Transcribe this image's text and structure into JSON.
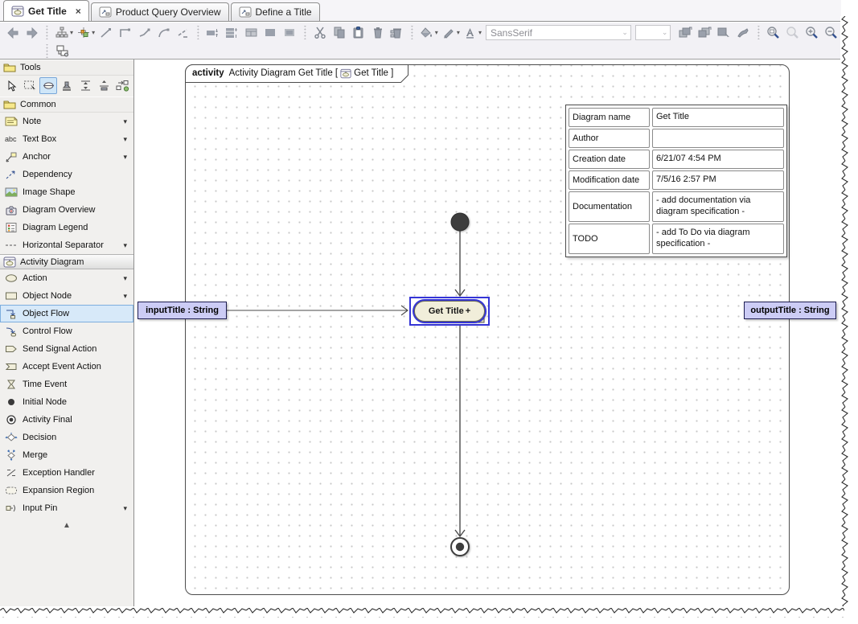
{
  "tabs": [
    {
      "label": "Get Title",
      "close_glyph": "×",
      "active": true
    },
    {
      "label": "Product Query Overview",
      "active": false
    },
    {
      "label": "Define a Title",
      "active": false
    }
  ],
  "toolbar": {
    "font_family": "SansSerif",
    "font_size": "",
    "combo_chevron": "⌄"
  },
  "palette": {
    "tools_header": "Tools",
    "common_header": "Common",
    "common_items": [
      {
        "label": "Note",
        "dropdown": "▾"
      },
      {
        "label": "Text Box",
        "dropdown": "▾"
      },
      {
        "label": "Anchor",
        "dropdown": "▾"
      },
      {
        "label": "Dependency",
        "dropdown": ""
      },
      {
        "label": "Image Shape",
        "dropdown": ""
      },
      {
        "label": "Diagram Overview",
        "dropdown": ""
      },
      {
        "label": "Diagram Legend",
        "dropdown": ""
      },
      {
        "label": "Horizontal Separator",
        "dropdown": "▾"
      }
    ],
    "activity_header": "Activity Diagram",
    "activity_items": [
      {
        "label": "Action",
        "dropdown": "▾"
      },
      {
        "label": "Object Node",
        "dropdown": "▾"
      },
      {
        "label": "Object Flow",
        "dropdown": "",
        "selected": true
      },
      {
        "label": "Control Flow",
        "dropdown": ""
      },
      {
        "label": "Send Signal Action",
        "dropdown": ""
      },
      {
        "label": "Accept Event Action",
        "dropdown": ""
      },
      {
        "label": "Time Event",
        "dropdown": ""
      },
      {
        "label": "Initial Node",
        "dropdown": ""
      },
      {
        "label": "Activity Final",
        "dropdown": ""
      },
      {
        "label": "Decision",
        "dropdown": ""
      },
      {
        "label": "Merge",
        "dropdown": ""
      },
      {
        "label": "Exception Handler",
        "dropdown": ""
      },
      {
        "label": "Expansion Region",
        "dropdown": ""
      },
      {
        "label": "Input Pin",
        "dropdown": "▾"
      }
    ],
    "scroll_up_glyph": "▲",
    "textbox_glyph": "abc"
  },
  "canvas": {
    "frame_header": {
      "keyword": "activity",
      "title": "Activity Diagram  Get Title [",
      "name_suffix": "Get Title ]"
    },
    "info_table": {
      "rows": [
        {
          "label": "Diagram name",
          "value": "Get Title"
        },
        {
          "label": "Author",
          "value": ""
        },
        {
          "label": "Creation date",
          "value": "6/21/07 4:54 PM"
        },
        {
          "label": "Modification date",
          "value": "7/5/16 2:57 PM"
        },
        {
          "label": "Documentation",
          "value": "- add documentation via diagram specification -"
        },
        {
          "label": "TODO",
          "value": "- add To Do via diagram specification -"
        }
      ]
    },
    "action_node": {
      "label": "Get Title",
      "manipulator": "+"
    },
    "input_label": "inputTitle : String",
    "output_label": "outputTitle : String"
  },
  "colors": {
    "selection_blue": "#3535d6",
    "action_fill": "#f1eeda",
    "action_border": "#6b6b55",
    "label_fill": "#ccccf5",
    "label_border": "#1c1c50",
    "palette_selection_bg": "#d6e9f9",
    "palette_selection_border": "#7dade0",
    "grid_dot": "#c7c7c7",
    "frame_border": "#4c4c4c"
  }
}
